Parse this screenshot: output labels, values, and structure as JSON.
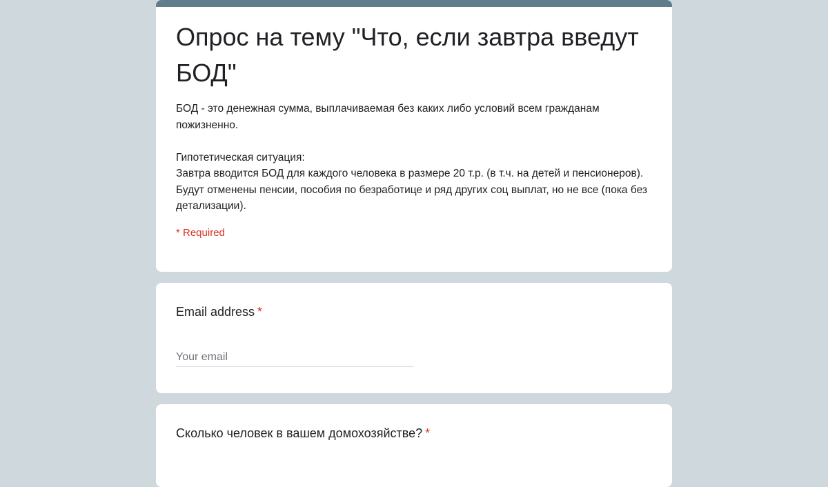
{
  "header": {
    "title": "Опрос на тему \"Что, если завтра введут БОД\"",
    "description": "БОД - это денежная сумма, выплачиваемая без каких либо условий всем гражданам пожизненно.\n\nГипотетическая ситуация:\nЗавтра вводится БОД для каждого человека в размере 20 т.р. (в т.ч. на детей и пенсионеров).\nБудут отменены пенсии, пособия по безработице и ряд других соц выплат, но не все (пока без детализации).",
    "required_note": "* Required",
    "accent_color": "#607d8b"
  },
  "questions": [
    {
      "title": "Email address",
      "required_mark": "*",
      "placeholder": "Your email",
      "value": ""
    },
    {
      "title": "Сколько человек в вашем домохозяйстве?",
      "required_mark": "*"
    }
  ],
  "colors": {
    "background": "#cfd8dc",
    "required": "#d93025",
    "text": "#202124"
  }
}
